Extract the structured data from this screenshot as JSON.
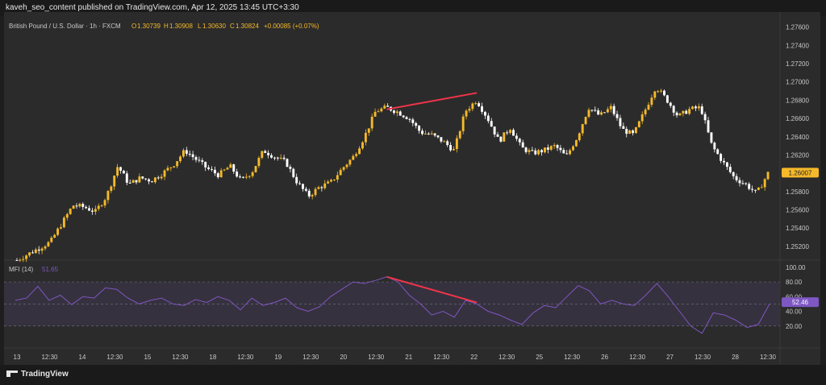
{
  "header": {
    "published": "kaveh_seo_content published on TradingView.com, Apr 12, 2025 13:45 UTC+3:30"
  },
  "chart_data": {
    "type": "candlestick",
    "symbol": "British Pound / U.S. Dollar · 1h · FXCM",
    "ohlc": {
      "o_label": "O",
      "o": "1.30739",
      "h_label": "H",
      "h": "1.30908",
      "l_label": "L",
      "l": "1.30630",
      "c_label": "C",
      "c": "1.30824",
      "change": "+0.00085 (+0.07%)"
    },
    "price_axis": {
      "ticks": [
        "1.27600",
        "1.27400",
        "1.27200",
        "1.27000",
        "1.26800",
        "1.26600",
        "1.26400",
        "1.26200",
        "1.26000",
        "1.25800",
        "1.25600",
        "1.25400",
        "1.25200"
      ],
      "ylim": [
        1.2512,
        1.2772
      ],
      "last_price": "1.26007"
    },
    "time_axis": {
      "labels": [
        "13",
        "12:30",
        "14",
        "12:30",
        "15",
        "12:30",
        "18",
        "12:30",
        "19",
        "12:30",
        "20",
        "12:30",
        "21",
        "12:30",
        "22",
        "12:30",
        "25",
        "12:30",
        "26",
        "12:30",
        "27",
        "12:30",
        "28",
        "12:30"
      ]
    },
    "price_path": [
      [
        0,
        1.2505
      ],
      [
        3,
        1.2525
      ],
      [
        4,
        1.2545
      ],
      [
        5,
        1.2565
      ],
      [
        6,
        1.2563
      ],
      [
        7,
        1.2558
      ],
      [
        8,
        1.2575
      ],
      [
        9,
        1.2608
      ],
      [
        10,
        1.2588
      ],
      [
        11,
        1.2595
      ],
      [
        12,
        1.2592
      ],
      [
        13,
        1.26
      ],
      [
        14,
        1.261
      ],
      [
        15,
        1.2625
      ],
      [
        16,
        1.2615
      ],
      [
        17,
        1.2605
      ],
      [
        18,
        1.2598
      ],
      [
        19,
        1.2608
      ],
      [
        20,
        1.2592
      ],
      [
        21,
        1.2602
      ],
      [
        22,
        1.2625
      ],
      [
        23,
        1.2618
      ],
      [
        24,
        1.2612
      ],
      [
        25,
        1.259
      ],
      [
        26,
        1.2575
      ],
      [
        27,
        1.2585
      ],
      [
        28,
        1.259
      ],
      [
        29,
        1.2605
      ],
      [
        30,
        1.2618
      ],
      [
        31,
        1.264
      ],
      [
        32,
        1.2668
      ],
      [
        33,
        1.2672
      ],
      [
        34,
        1.2667
      ],
      [
        35,
        1.266
      ],
      [
        36,
        1.2645
      ],
      [
        37,
        1.2642
      ],
      [
        38,
        1.2635
      ],
      [
        39,
        1.2625
      ],
      [
        40,
        1.2668
      ],
      [
        41,
        1.268
      ],
      [
        42,
        1.266
      ],
      [
        43,
        1.2635
      ],
      [
        44,
        1.265
      ],
      [
        45,
        1.2628
      ],
      [
        46,
        1.2622
      ],
      [
        47,
        1.2625
      ],
      [
        48,
        1.263
      ],
      [
        49,
        1.2618
      ],
      [
        50,
        1.264
      ],
      [
        51,
        1.2672
      ],
      [
        52,
        1.2663
      ],
      [
        53,
        1.2672
      ],
      [
        54,
        1.2648
      ],
      [
        55,
        1.2642
      ],
      [
        56,
        1.2668
      ],
      [
        57,
        1.2695
      ],
      [
        58,
        1.268
      ],
      [
        59,
        1.2662
      ],
      [
        60,
        1.267
      ],
      [
        61,
        1.2672
      ],
      [
        62,
        1.263
      ],
      [
        63,
        1.2612
      ],
      [
        64,
        1.2595
      ],
      [
        65,
        1.2588
      ],
      [
        66,
        1.2578
      ],
      [
        67,
        1.26
      ]
    ],
    "mfi": {
      "label": "MFI (14)",
      "value": "51.65",
      "last_value": "52.46",
      "ticks": [
        "100.00",
        "80.00",
        "60.00",
        "40.00",
        "20.00"
      ],
      "upper_band": 80,
      "lower_band": 20,
      "path": [
        [
          0,
          55
        ],
        [
          1,
          58
        ],
        [
          2,
          74
        ],
        [
          3,
          55
        ],
        [
          4,
          62
        ],
        [
          5,
          49
        ],
        [
          6,
          60
        ],
        [
          7,
          58
        ],
        [
          8,
          72
        ],
        [
          9,
          70
        ],
        [
          10,
          58
        ],
        [
          11,
          50
        ],
        [
          12,
          55
        ],
        [
          13,
          58
        ],
        [
          14,
          50
        ],
        [
          15,
          48
        ],
        [
          16,
          56
        ],
        [
          17,
          52
        ],
        [
          18,
          60
        ],
        [
          19,
          55
        ],
        [
          20,
          42
        ],
        [
          21,
          58
        ],
        [
          22,
          48
        ],
        [
          23,
          52
        ],
        [
          24,
          58
        ],
        [
          25,
          45
        ],
        [
          26,
          40
        ],
        [
          27,
          46
        ],
        [
          28,
          60
        ],
        [
          29,
          70
        ],
        [
          30,
          80
        ],
        [
          31,
          78
        ],
        [
          32,
          82
        ],
        [
          33,
          87
        ],
        [
          34,
          80
        ],
        [
          35,
          62
        ],
        [
          36,
          50
        ],
        [
          37,
          35
        ],
        [
          38,
          40
        ],
        [
          39,
          32
        ],
        [
          40,
          55
        ],
        [
          41,
          50
        ],
        [
          42,
          40
        ],
        [
          43,
          35
        ],
        [
          44,
          28
        ],
        [
          45,
          22
        ],
        [
          46,
          38
        ],
        [
          47,
          48
        ],
        [
          48,
          45
        ],
        [
          49,
          60
        ],
        [
          50,
          75
        ],
        [
          51,
          68
        ],
        [
          52,
          50
        ],
        [
          53,
          55
        ],
        [
          54,
          50
        ],
        [
          55,
          48
        ],
        [
          56,
          62
        ],
        [
          57,
          78
        ],
        [
          58,
          60
        ],
        [
          59,
          40
        ],
        [
          60,
          20
        ],
        [
          61,
          10
        ],
        [
          62,
          38
        ],
        [
          63,
          35
        ],
        [
          64,
          28
        ],
        [
          65,
          18
        ],
        [
          66,
          22
        ],
        [
          67,
          50
        ]
      ]
    },
    "divergence": {
      "price_start": [
        33,
        1.267
      ],
      "price_end": [
        41,
        1.2688
      ],
      "mfi_start": [
        33,
        87
      ],
      "mfi_end": [
        41,
        52
      ],
      "color": "#f0344a"
    },
    "colors": {
      "up": "#f5b92a",
      "down": "#ffffff",
      "mfi_line": "#7e57c2",
      "mfi_band_fill": "#3a3344",
      "last_price_label": "#f5b92a",
      "mfi_last_label": "#7e57c2",
      "mfi_value": "#7e57c2"
    }
  },
  "footer": {
    "brand": "TradingView"
  }
}
